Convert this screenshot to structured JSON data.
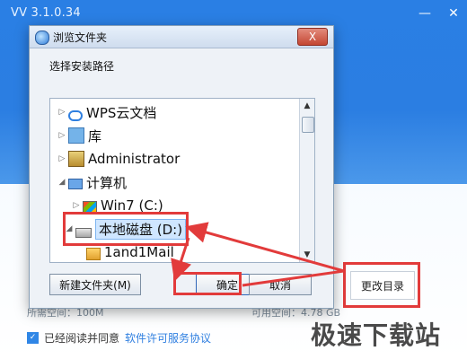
{
  "installer": {
    "title": "VV 3.1.0.34",
    "min_icon": "minimize-icon",
    "close_icon": "close-icon",
    "required_space": "所需空间：100M",
    "available_space": "可用空间：4.78 GB",
    "agree_prefix": "已经阅读并同意",
    "agree_link": "软件许可服务协议",
    "change_dir_button": "更改目录"
  },
  "dialog": {
    "title": "浏览文件夹",
    "description": "选择安装路径",
    "close_symbol": "X",
    "tree": [
      {
        "label": "WPS云文档",
        "icon": "cloud-icon",
        "arrow": "▷"
      },
      {
        "label": "库",
        "icon": "library-icon",
        "arrow": "▷"
      },
      {
        "label": "Administrator",
        "icon": "user-folder-icon",
        "arrow": "▷"
      },
      {
        "label": "计算机",
        "icon": "computer-icon",
        "arrow": "◢"
      },
      {
        "label": "Win7 (C:)",
        "icon": "windows-drive-icon",
        "arrow": "▷"
      },
      {
        "label": "本地磁盘 (D:)",
        "icon": "disk-icon",
        "arrow": "◢"
      },
      {
        "label": "1and1Mail",
        "icon": "folder-icon",
        "arrow": ""
      }
    ],
    "buttons": {
      "new_folder": "新建文件夹(M)",
      "ok": "确定",
      "cancel": "取消"
    }
  },
  "watermark": "极速下载站",
  "colors": {
    "accent": "#2f86e6",
    "annotation": "#e23b3b"
  }
}
